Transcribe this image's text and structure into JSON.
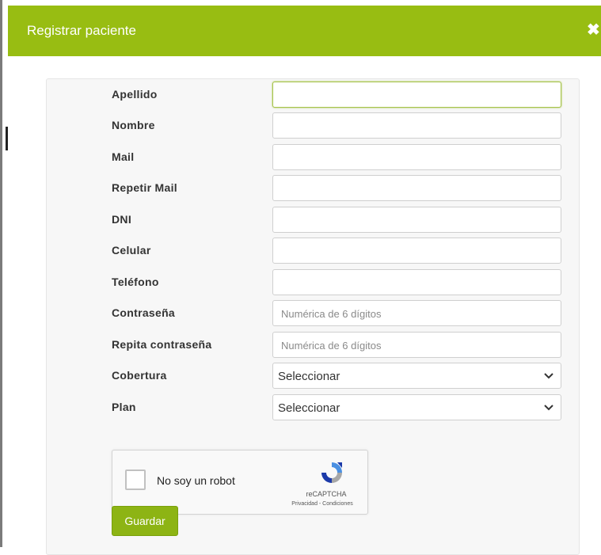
{
  "dialog": {
    "title": "Registrar paciente",
    "close_symbol": "✖"
  },
  "colors": {
    "header_bg": "#98bd12",
    "save_bg": "#8db414",
    "focus_border": "#a6c34a"
  },
  "form": {
    "fields": [
      {
        "label": "Apellido",
        "value": "",
        "placeholder": ""
      },
      {
        "label": "Nombre",
        "value": "",
        "placeholder": ""
      },
      {
        "label": "Mail",
        "value": "",
        "placeholder": ""
      },
      {
        "label": "Repetir Mail",
        "value": "",
        "placeholder": ""
      },
      {
        "label": "DNI",
        "value": "",
        "placeholder": ""
      },
      {
        "label": "Celular",
        "value": "",
        "placeholder": ""
      },
      {
        "label": "Teléfono",
        "value": "",
        "placeholder": ""
      },
      {
        "label": "Contraseña",
        "value": "",
        "placeholder": "Numérica de 6 dígitos"
      },
      {
        "label": "Repita contraseña",
        "value": "",
        "placeholder": "Numérica de 6 dígitos"
      }
    ],
    "selects": [
      {
        "label": "Cobertura",
        "selected": "Seleccionar",
        "icon": "chevron-down-icon"
      },
      {
        "label": "Plan",
        "selected": "Seleccionar",
        "icon": "chevron-down-icon"
      }
    ],
    "captcha": {
      "label": "No soy un robot",
      "brand": "reCAPTCHA",
      "links": "Privacidad - Condiciones",
      "icon": "recaptcha-logo-icon"
    },
    "save_label": "Guardar"
  }
}
